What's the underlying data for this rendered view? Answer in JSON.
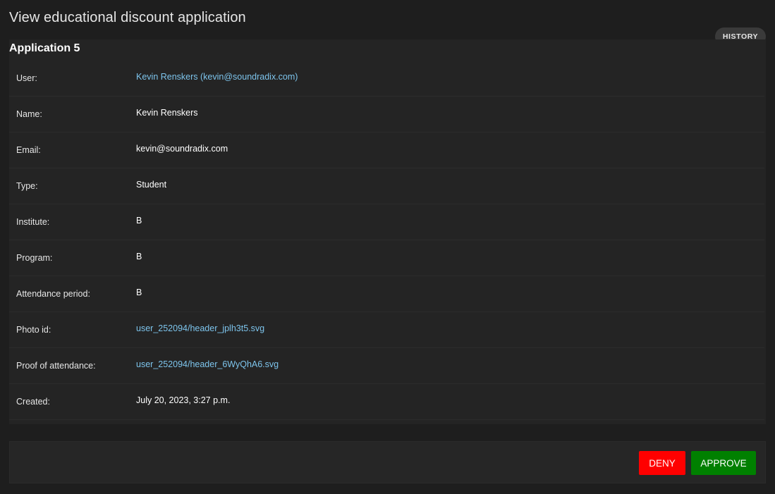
{
  "page": {
    "title": "View educational discount application",
    "history_label": "HISTORY"
  },
  "application": {
    "title": "Application 5",
    "fields": [
      {
        "label": "User:",
        "value": "Kevin Renskers (kevin@soundradix.com)",
        "link": true
      },
      {
        "label": "Name:",
        "value": "Kevin Renskers",
        "link": false
      },
      {
        "label": "Email:",
        "value": "kevin@soundradix.com",
        "link": false
      },
      {
        "label": "Type:",
        "value": "Student",
        "link": false
      },
      {
        "label": "Institute:",
        "value": "B",
        "link": false
      },
      {
        "label": "Program:",
        "value": "B",
        "link": false
      },
      {
        "label": "Attendance period:",
        "value": "B",
        "link": false
      },
      {
        "label": "Photo id:",
        "value": "user_252094/header_jplh3t5.svg",
        "link": true
      },
      {
        "label": "Proof of attendance:",
        "value": "user_252094/header_6WyQhA6.svg",
        "link": true
      },
      {
        "label": "Created:",
        "value": "July 20, 2023, 3:27 p.m.",
        "link": false
      }
    ]
  },
  "actions": {
    "deny_label": "DENY",
    "approve_label": "APPROVE"
  },
  "colors": {
    "deny": "#ff0000",
    "approve": "#008000",
    "link": "#7dc4ec"
  }
}
